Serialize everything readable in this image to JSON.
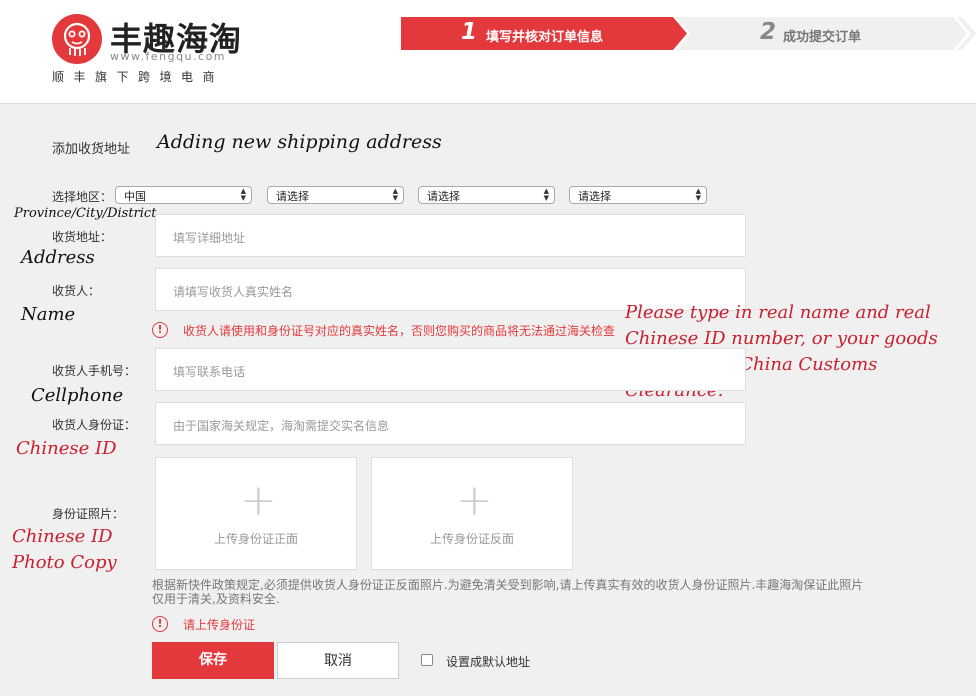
{
  "header": {
    "brand_name": "丰趣海淘",
    "brand_url": "www.fengqu.com",
    "tagline": "顺丰旗下跨境电商",
    "steps": [
      {
        "number": "1",
        "label": "填写并核对订单信息",
        "active": true
      },
      {
        "number": "2",
        "label": "成功提交订单",
        "active": false
      }
    ],
    "colors": {
      "accent": "#e4393c",
      "inactive_step": "#f0f0f0"
    }
  },
  "form": {
    "title_cn": "添加收货地址",
    "title_en": "Adding new shipping address",
    "region": {
      "label": "选择地区：",
      "annotation": "Province/City/District",
      "selects": [
        "中国",
        "请选择",
        "请选择",
        "请选择"
      ]
    },
    "address": {
      "label": "收货地址：",
      "annotation": "Address",
      "placeholder": "填写详细地址"
    },
    "name": {
      "label": "收货人：",
      "annotation": "Name",
      "placeholder": "请填写收货人真实姓名",
      "warning": "收货人请使用和身份证号对应的真实姓名，否则您购买的商品将无法通过海关检查"
    },
    "name_annotation": "Please type in real name and real Chinese ID number, or your goods cannot pass China Customs Clearance.",
    "phone": {
      "label": "收货人手机号：",
      "annotation": "Cellphone",
      "placeholder": "填写联系电话"
    },
    "id_number": {
      "label": "收货人身份证：",
      "annotation": "Chinese ID",
      "placeholder": "由于国家海关规定，海淘需提交实名信息"
    },
    "id_photo": {
      "label": "身份证照片：",
      "annotation_line1": "Chinese ID",
      "annotation_line2": "Photo Copy",
      "front_label": "上传身份证正面",
      "back_label": "上传身份证反面"
    },
    "note": "根据新快件政策规定,必须提供收货人身份证正反面照片.为避免清关受到影响,请上传真实有效的收货人身份证照片.丰趣海淘保证此照片仅用于清关,及资料安全.",
    "upload_warning": "请上传身份证",
    "save_label": "保存",
    "cancel_label": "取消",
    "default_label": "设置成默认地址"
  }
}
